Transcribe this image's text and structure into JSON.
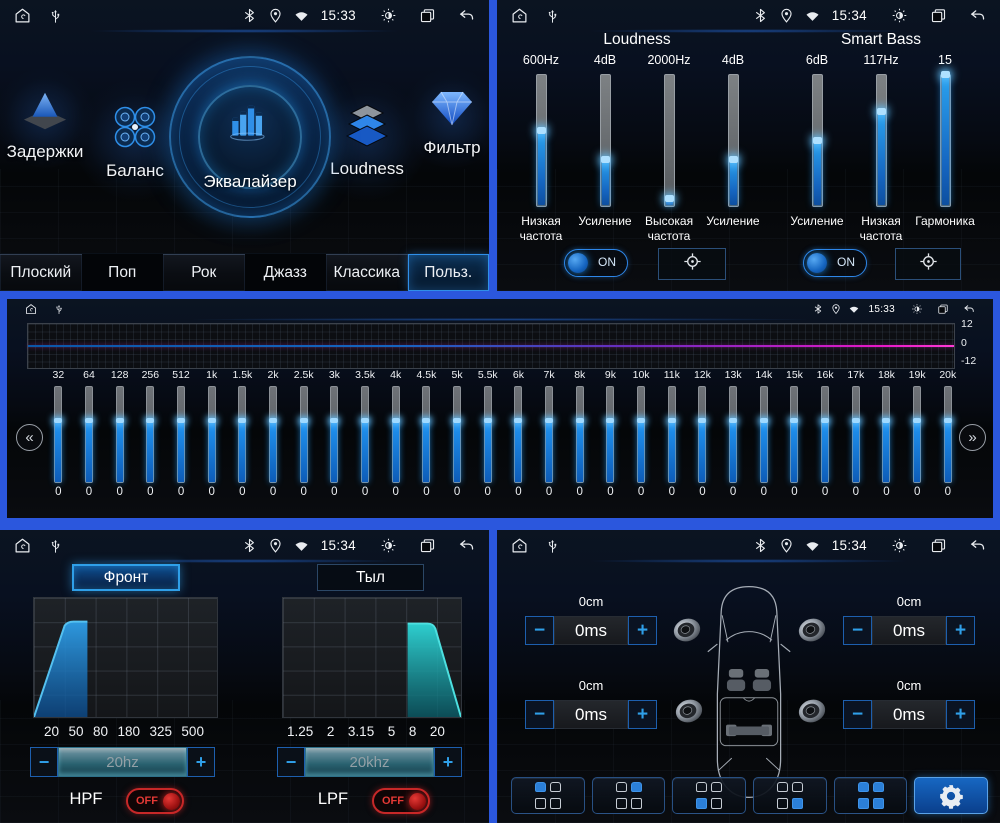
{
  "frame_color": "#2b57dd",
  "eq_home": {
    "time": "15:33",
    "carousel": [
      {
        "label": "Задержки",
        "icon": "delays-pyramid-icon"
      },
      {
        "label": "Баланс",
        "icon": "balance-speakers-icon"
      },
      {
        "label": "Эквалайзер",
        "icon": "equalizer-bars-icon",
        "active": true
      },
      {
        "label": "Loudness",
        "icon": "loudness-layers-icon"
      },
      {
        "label": "Фильтр",
        "icon": "filter-diamond-icon"
      }
    ],
    "presets": [
      {
        "label": "Плоский",
        "selected": false
      },
      {
        "label": "Поп",
        "selected": false
      },
      {
        "label": "Рок",
        "selected": false
      },
      {
        "label": "Джазз",
        "selected": false
      },
      {
        "label": "Классика",
        "selected": false
      },
      {
        "label": "Польз.",
        "selected": true
      }
    ]
  },
  "loudness_panel": {
    "time": "15:34",
    "sections": [
      {
        "title": "Loudness"
      },
      {
        "title": "Smart Bass"
      }
    ],
    "sliders": [
      {
        "value": "600Hz",
        "label": "Низкая частота",
        "fill_pct": 57
      },
      {
        "value": "4dB",
        "label": "Усиление",
        "fill_pct": 35
      },
      {
        "value": "2000Hz",
        "label": "Высокая частота",
        "fill_pct": 5
      },
      {
        "value": "4dB",
        "label": "Усиление",
        "fill_pct": 35
      },
      {
        "value": "6dB",
        "label": "Усиление",
        "fill_pct": 50
      },
      {
        "value": "117Hz",
        "label": "Низкая частота",
        "fill_pct": 72
      },
      {
        "value": "15",
        "label": "Гармоника",
        "fill_pct": 100
      }
    ],
    "toggles": [
      {
        "label": "ON",
        "state": "on"
      },
      {
        "label": "ON",
        "state": "on"
      }
    ]
  },
  "equalizer_panel": {
    "time": "15:33",
    "scale_labels": [
      "12",
      "0",
      "-12"
    ],
    "band_fill_pct": 65,
    "bands": [
      {
        "freq": "32",
        "value": "0"
      },
      {
        "freq": "64",
        "value": "0"
      },
      {
        "freq": "128",
        "value": "0"
      },
      {
        "freq": "256",
        "value": "0"
      },
      {
        "freq": "512",
        "value": "0"
      },
      {
        "freq": "1k",
        "value": "0"
      },
      {
        "freq": "1.5k",
        "value": "0"
      },
      {
        "freq": "2k",
        "value": "0"
      },
      {
        "freq": "2.5k",
        "value": "0"
      },
      {
        "freq": "3k",
        "value": "0"
      },
      {
        "freq": "3.5k",
        "value": "0"
      },
      {
        "freq": "4k",
        "value": "0"
      },
      {
        "freq": "4.5k",
        "value": "0"
      },
      {
        "freq": "5k",
        "value": "0"
      },
      {
        "freq": "5.5k",
        "value": "0"
      },
      {
        "freq": "6k",
        "value": "0"
      },
      {
        "freq": "7k",
        "value": "0"
      },
      {
        "freq": "8k",
        "value": "0"
      },
      {
        "freq": "9k",
        "value": "0"
      },
      {
        "freq": "10k",
        "value": "0"
      },
      {
        "freq": "11k",
        "value": "0"
      },
      {
        "freq": "12k",
        "value": "0"
      },
      {
        "freq": "13k",
        "value": "0"
      },
      {
        "freq": "14k",
        "value": "0"
      },
      {
        "freq": "15k",
        "value": "0"
      },
      {
        "freq": "16k",
        "value": "0"
      },
      {
        "freq": "17k",
        "value": "0"
      },
      {
        "freq": "18k",
        "value": "0"
      },
      {
        "freq": "19k",
        "value": "0"
      },
      {
        "freq": "20k",
        "value": "0"
      }
    ]
  },
  "filter_panel": {
    "time": "15:34",
    "tabs": [
      {
        "label": "Фронт",
        "selected": true
      },
      {
        "label": "Тыл",
        "selected": false
      }
    ],
    "hpf": {
      "name": "HPF",
      "x_labels": [
        "20",
        "50",
        "80",
        "180",
        "325",
        "500"
      ],
      "value": "20hz",
      "toggle_label": "OFF",
      "toggle_state": "off"
    },
    "lpf": {
      "name": "LPF",
      "x_labels": [
        "1.25",
        "2",
        "3.15",
        "5",
        "8",
        "20"
      ],
      "value": "20khz",
      "toggle_label": "OFF",
      "toggle_state": "off"
    }
  },
  "delays_panel": {
    "time": "15:34",
    "groups": [
      {
        "position": "front-left",
        "distance": "0cm",
        "delay": "0ms"
      },
      {
        "position": "front-right",
        "distance": "0cm",
        "delay": "0ms"
      },
      {
        "position": "rear-left",
        "distance": "0cm",
        "delay": "0ms"
      },
      {
        "position": "rear-right",
        "distance": "0cm",
        "delay": "0ms"
      }
    ],
    "toolbar": [
      {
        "name": "seat-front-left"
      },
      {
        "name": "seat-front-right"
      },
      {
        "name": "seat-rear-left"
      },
      {
        "name": "seat-rear-right"
      },
      {
        "name": "seat-all"
      },
      {
        "name": "settings",
        "selected": true
      }
    ]
  }
}
